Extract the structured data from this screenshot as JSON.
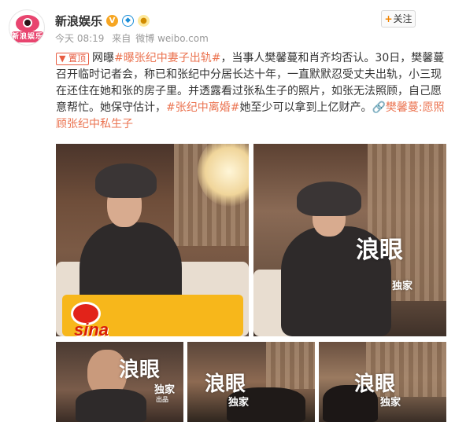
{
  "account": {
    "name": "新浪娱乐",
    "avatar_text": "新浪娱乐",
    "badges": [
      "V",
      "vip",
      "bulb"
    ],
    "time": "今天 08:19",
    "source_prefix": "来自",
    "source": "微博 weibo.com"
  },
  "follow": {
    "plus": "+",
    "label": "关注"
  },
  "post": {
    "pin_label": "置顶",
    "p1": "网曝",
    "link1": "#曝张纪中妻子出轨#",
    "p2": "，当事人樊馨蔓和肖齐均否认。30日，樊馨蔓召开临时记者会，称已和张纪中分居长达十年，一直默默忍受丈夫出轨，小三现在还住在她和张的房子里。并透露看过张私生子的照片，如张无法照顾，自己愿意帮忙。她保守估计，",
    "link2": "#张纪中离婚#",
    "p3": "她至少可以拿到上亿财产。",
    "link3": "樊馨蔓:愿照顾张纪中私生子",
    "link3_prefix": "🔗"
  },
  "photos": {
    "watermark_big": "浪眼",
    "watermark_small": "独家",
    "watermark_tiny": "出品",
    "sina": "sina"
  },
  "colors": {
    "accent": "#eb7350",
    "follow_plus": "#f08300",
    "pin": "#e85c41"
  }
}
